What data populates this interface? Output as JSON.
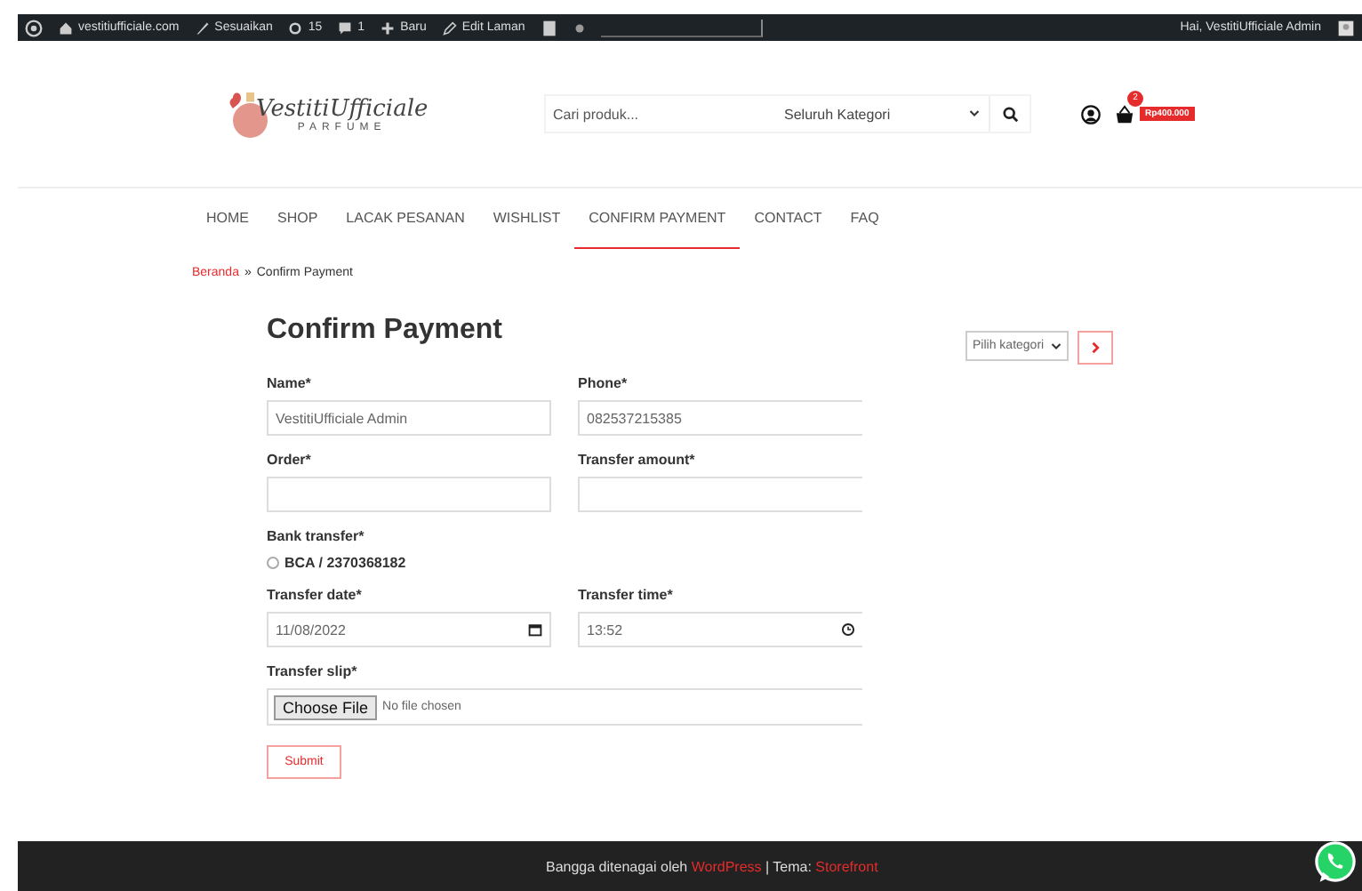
{
  "admin_bar": {
    "site": "vestitiufficiale.com",
    "customize": "Sesuaikan",
    "updates": "15",
    "comments": "1",
    "new": "Baru",
    "edit": "Edit Laman",
    "greeting": "Hai, VestitiUfficiale Admin"
  },
  "header": {
    "logo": {
      "name": "VestitiUfficiale",
      "tagline": "PARFUME"
    },
    "search": {
      "placeholder": "Cari produk...",
      "category": "Seluruh Kategori"
    },
    "cart": {
      "count": "2",
      "total": "Rp400.000"
    }
  },
  "nav": [
    {
      "label": "HOME",
      "selected": false
    },
    {
      "label": "SHOP",
      "selected": false
    },
    {
      "label": "LACAK PESANAN",
      "selected": false
    },
    {
      "label": "WISHLIST",
      "selected": false
    },
    {
      "label": "CONFIRM PAYMENT",
      "selected": true
    },
    {
      "label": "CONTACT",
      "selected": false
    },
    {
      "label": "FAQ",
      "selected": false
    }
  ],
  "breadcrumb": {
    "items": [
      "Beranda",
      "Confirm Payment"
    ],
    "separator": "»"
  },
  "page": {
    "title": "Confirm Payment",
    "rows": [
      [
        {
          "kind": "text",
          "label": "Name*",
          "value": "VestitiUfficiale Admin"
        },
        {
          "kind": "text",
          "label": "Phone*",
          "value": "082537215385"
        }
      ],
      [
        {
          "kind": "text",
          "label": "Order*"
        },
        {
          "kind": "text",
          "label": "Transfer amount*"
        }
      ],
      [
        {
          "kind": "radio",
          "label": "Bank transfer*",
          "options": [
            {
              "label": "BCA / 2370368182",
              "selected": false
            }
          ]
        }
      ],
      [
        {
          "kind": "date",
          "label": "Transfer date*",
          "value": "11/08/2022"
        },
        {
          "kind": "time",
          "label": "Transfer time*",
          "value": "13:52"
        }
      ],
      [
        {
          "kind": "file",
          "label": "Transfer slip*",
          "button": "Choose File",
          "status": "No file chosen"
        }
      ]
    ],
    "submit": "Submit"
  },
  "sidebar": {
    "select": "Pilih kategori"
  },
  "footer": {
    "text": "Bangga ditenagai oleh",
    "link": "WordPress",
    "separator": "|",
    "theme_label": "Tema:",
    "theme_link": "Storefront"
  }
}
